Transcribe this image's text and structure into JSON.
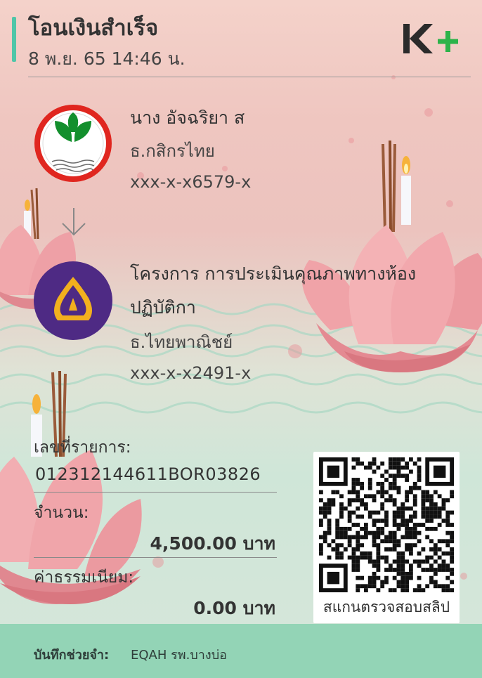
{
  "header": {
    "title": "โอนเงินสำเร็จ",
    "datetime": "8 พ.ย. 65  14:46 น.",
    "logo_name": "K+"
  },
  "sender": {
    "name": "นาง อัจฉริยา ส",
    "bank": "ธ.กสิกรไทย",
    "account": "xxx-x-x6579-x",
    "bank_color": "#138f2d"
  },
  "receiver": {
    "name_line1": "โครงการ การประเมินคุณภาพทางห้อง",
    "name_line2": "ปฏิบัติกา",
    "bank": "ธ.ไทยพาณิชย์",
    "account": "xxx-x-x2491-x",
    "bank_color": "#4e2a84"
  },
  "details": {
    "ref_label": "เลขที่รายการ:",
    "ref_value": "012312144611BOR03826",
    "amount_label": "จำนวน:",
    "amount_value": "4,500.00 บาท",
    "fee_label": "ค่าธรรมเนียม:",
    "fee_value": "0.00 บาท"
  },
  "qr": {
    "caption": "สแกนตรวจสอบสลิป"
  },
  "footer": {
    "memo_label": "บันทึกช่วยจำ:",
    "memo_value": "EQAH รพ.บางบ่อ"
  },
  "colors": {
    "accent": "#4fc6a8",
    "footer_bg": "#93d4b6",
    "logo_green": "#2cb34a",
    "logo_dark": "#2b2b2b"
  }
}
